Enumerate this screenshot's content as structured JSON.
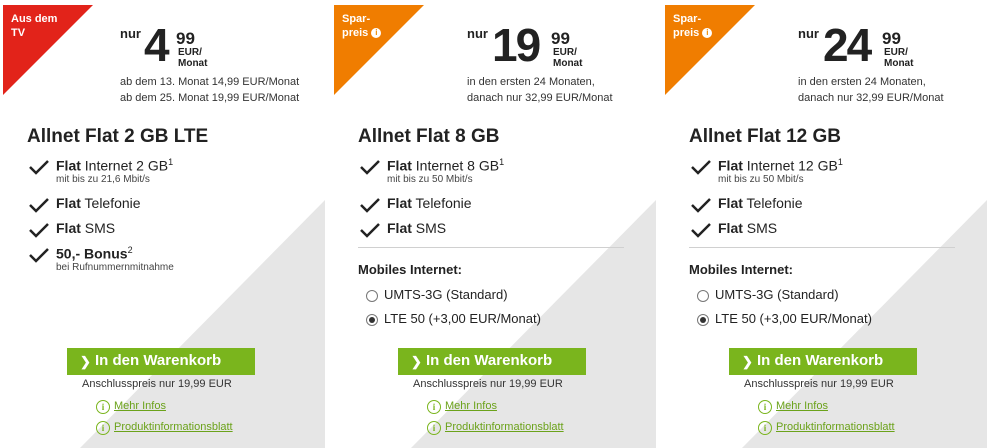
{
  "colors": {
    "accent_green": "#7ab51d",
    "badge_red": "#e2231a",
    "badge_orange": "#f07d00"
  },
  "cards": [
    {
      "badge": {
        "line1": "Aus dem",
        "line2": "TV",
        "color": "#e2231a"
      },
      "price": {
        "prefix": "nur",
        "main": "4",
        "cents": "99",
        "unit1": "EUR/",
        "unit2": "Monat"
      },
      "note1": "ab dem 13. Monat 14,99 EUR/Monat",
      "note2": "ab dem 25. Monat 19,99 EUR/Monat",
      "title": "Allnet Flat 2 GB LTE",
      "features": [
        {
          "bold": "Flat",
          "text": " Internet 2 GB",
          "sup": "1",
          "sub": "mit bis zu 21,6 Mbit/s"
        },
        {
          "bold": "Flat",
          "text": " Telefonie",
          "sup": "",
          "sub": ""
        },
        {
          "bold": "Flat",
          "text": " SMS",
          "sup": "",
          "sub": ""
        },
        {
          "bold": "50,- Bonus",
          "text": "",
          "sup": "2",
          "sub": "bei Rufnummernmitnahme"
        }
      ],
      "cart": "In den Warenkorb",
      "conn": "Anschlusspreis nur 19,99 EUR",
      "more": "Mehr Infos",
      "pib": "Produktinformationsblatt"
    },
    {
      "badge": {
        "line1": "Spar-",
        "line2": "preis",
        "color": "#f07d00"
      },
      "price": {
        "prefix": "nur",
        "main": "19",
        "cents": "99",
        "unit1": "EUR/",
        "unit2": "Monat"
      },
      "note1": "in den ersten 24 Monaten,",
      "note2": "danach nur 32,99 EUR/Monat",
      "title": "Allnet Flat 8 GB",
      "features": [
        {
          "bold": "Flat",
          "text": " Internet 8 GB",
          "sup": "1",
          "sub": "mit bis zu 50 Mbit/s"
        },
        {
          "bold": "Flat",
          "text": " Telefonie",
          "sup": "",
          "sub": ""
        },
        {
          "bold": "Flat",
          "text": " SMS",
          "sup": "",
          "sub": ""
        }
      ],
      "mobile_label": "Mobiles Internet:",
      "options": [
        {
          "label": "UMTS-3G (Standard)",
          "selected": false
        },
        {
          "label": "LTE 50 (+3,00 EUR/Monat)",
          "selected": true
        }
      ],
      "cart": "In den Warenkorb",
      "conn": "Anschlusspreis nur 19,99 EUR",
      "more": "Mehr Infos",
      "pib": "Produktinformationsblatt"
    },
    {
      "badge": {
        "line1": "Spar-",
        "line2": "preis",
        "color": "#f07d00"
      },
      "price": {
        "prefix": "nur",
        "main": "24",
        "cents": "99",
        "unit1": "EUR/",
        "unit2": "Monat"
      },
      "note1": "in den ersten 24 Monaten,",
      "note2": "danach nur 32,99 EUR/Monat",
      "title": "Allnet Flat 12 GB",
      "features": [
        {
          "bold": "Flat",
          "text": " Internet 12 GB",
          "sup": "1",
          "sub": "mit bis zu 50 Mbit/s"
        },
        {
          "bold": "Flat",
          "text": " Telefonie",
          "sup": "",
          "sub": ""
        },
        {
          "bold": "Flat",
          "text": " SMS",
          "sup": "",
          "sub": ""
        }
      ],
      "mobile_label": "Mobiles Internet:",
      "options": [
        {
          "label": "UMTS-3G (Standard)",
          "selected": false
        },
        {
          "label": "LTE 50 (+3,00 EUR/Monat)",
          "selected": true
        }
      ],
      "cart": "In den Warenkorb",
      "conn": "Anschlusspreis nur 19,99 EUR",
      "more": "Mehr Infos",
      "pib": "Produktinformationsblatt"
    }
  ]
}
